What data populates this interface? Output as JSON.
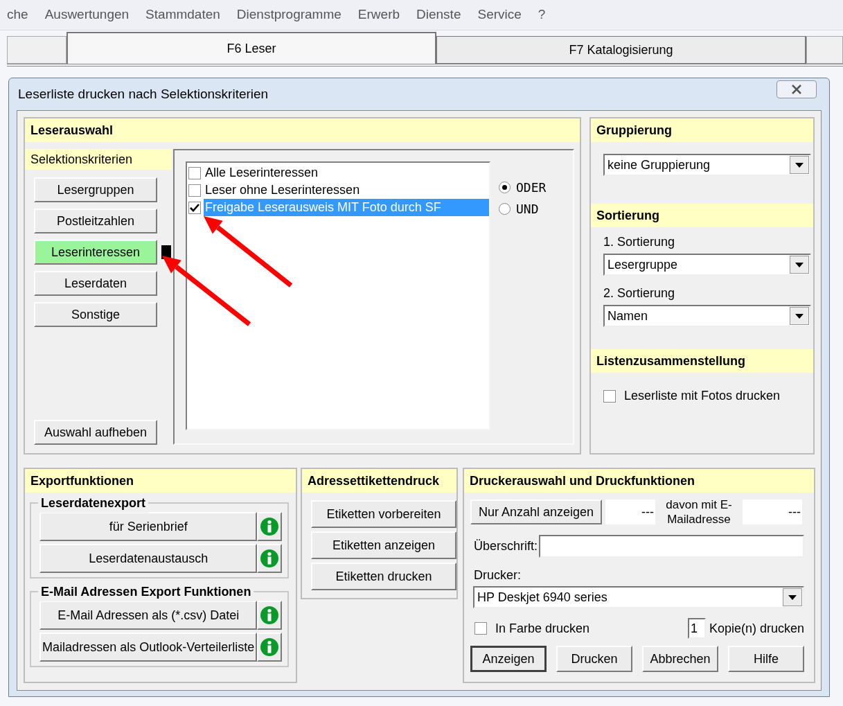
{
  "menu_bar": [
    "che",
    "Auswertungen",
    "Stammdaten",
    "Dienstprogramme",
    "Erwerb",
    "Dienste",
    "Service",
    "?"
  ],
  "tabs": [
    {
      "label": "F6 Leser",
      "selected": true
    },
    {
      "label": "F7 Katalogisierung",
      "selected": false
    }
  ],
  "dialog": {
    "title": "Leserliste drucken nach Selektionskriterien"
  },
  "leserauswahl": {
    "title": "Leserauswahl",
    "criteria_title": "Selektionskriterien",
    "criteria": [
      {
        "label": "Lesergruppen",
        "selected": false
      },
      {
        "label": "Postleitzahlen",
        "selected": false
      },
      {
        "label": "Leserinteressen",
        "selected": true
      },
      {
        "label": "Leserdaten",
        "selected": false
      },
      {
        "label": "Sonstige",
        "selected": false
      }
    ],
    "clear_button": "Auswahl aufheben",
    "options": [
      {
        "label": "Alle Leserinteressen",
        "checked": false,
        "selected": false
      },
      {
        "label": "Leser ohne Leserinteressen",
        "checked": false,
        "selected": false
      },
      {
        "label": "Freigabe Leserausweis MIT Foto durch SF",
        "checked": true,
        "selected": true
      }
    ],
    "logic": [
      {
        "label": "ODER",
        "selected": true
      },
      {
        "label": "UND",
        "selected": false
      }
    ]
  },
  "gruppierung": {
    "title": "Gruppierung",
    "value": "keine Gruppierung"
  },
  "sortierung": {
    "title": "Sortierung",
    "sorts": [
      {
        "label": "1. Sortierung",
        "value": "Lesergruppe"
      },
      {
        "label": "2. Sortierung",
        "value": "Namen"
      }
    ]
  },
  "listenzusammenstellung": {
    "title": "Listenzusammenstellung",
    "options": [
      {
        "label": "Leserliste mit Fotos drucken",
        "checked": false
      }
    ]
  },
  "exportfunktionen": {
    "title": "Exportfunktionen",
    "groups": [
      {
        "title": "Leserdatenexport",
        "buttons": [
          "für Serienbrief",
          "Leserdatenaustausch"
        ]
      },
      {
        "title": "E-Mail Adressen Export Funktionen",
        "buttons": [
          "E-Mail Adressen als (*.csv) Datei",
          "Mailadressen als Outlook-Verteilerliste"
        ]
      }
    ]
  },
  "adressettikettendruck": {
    "title": "Adressettikettendruck",
    "buttons": [
      "Etiketten vorbereiten",
      "Etiketten anzeigen",
      "Etiketten drucken"
    ]
  },
  "druck": {
    "title": "Druckerauswahl und Druckfunktionen",
    "count_button": "Nur Anzahl anzeigen",
    "count_value": "---",
    "email_label": "davon mit E-Mailadresse",
    "email_value": "---",
    "heading_label": "Überschrift:",
    "printer_label": "Drucker:",
    "printer": "HP Deskjet 6940 series",
    "color_option": {
      "label": "In Farbe drucken",
      "checked": false
    },
    "copies": "1",
    "copies_label": "Kopie(n) drucken",
    "buttons": [
      {
        "label": "Anzeigen",
        "default": true
      },
      {
        "label": "Drucken",
        "default": false
      },
      {
        "label": "Abbrechen",
        "default": false
      },
      {
        "label": "Hilfe",
        "default": false
      }
    ]
  }
}
